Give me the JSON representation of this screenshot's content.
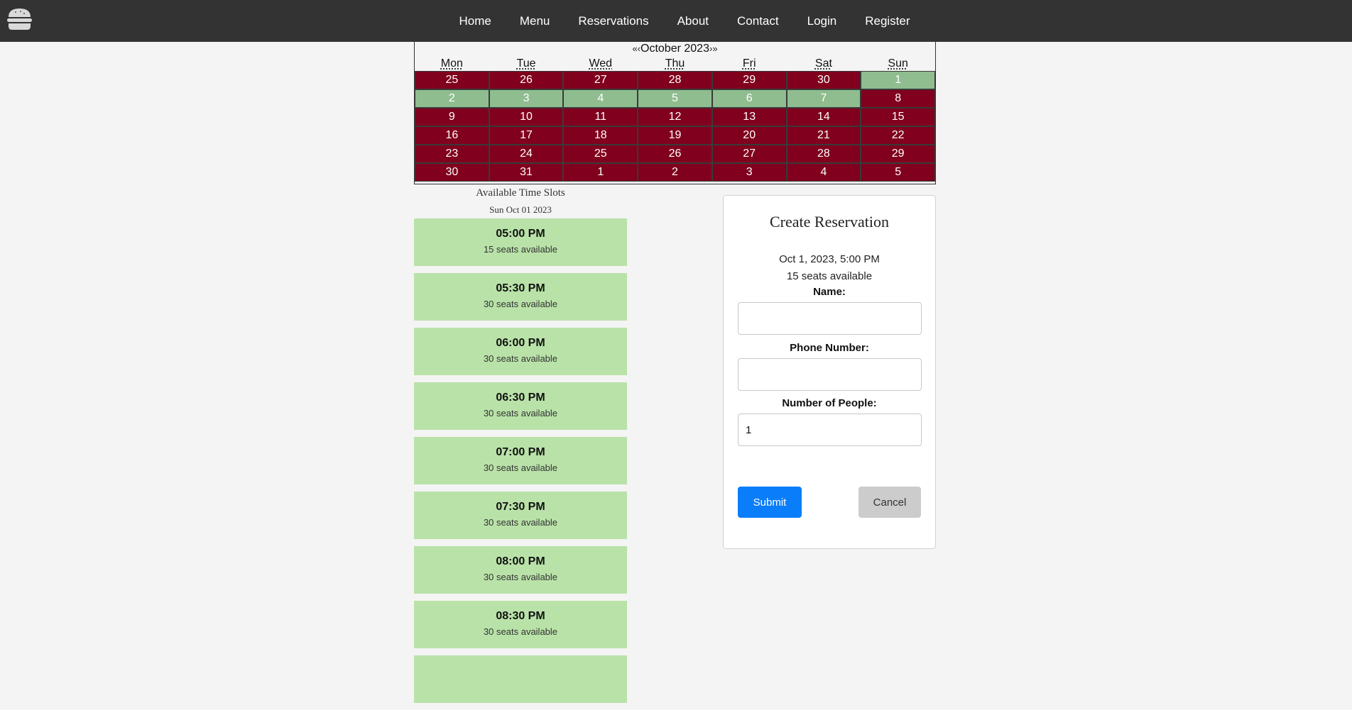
{
  "nav": {
    "logo_icon": "burger-icon",
    "links": [
      "Home",
      "Menu",
      "Reservations",
      "About",
      "Contact",
      "Login",
      "Register"
    ]
  },
  "calendar": {
    "prev_year": "«",
    "prev_month": "‹",
    "month_label": "October 2023",
    "next_month": "›",
    "next_year": "»",
    "weekdays": [
      "Mon",
      "Tue",
      "Wed",
      "Thu",
      "Fri",
      "Sat",
      "Sun"
    ],
    "days": [
      "25",
      "26",
      "27",
      "28",
      "29",
      "30",
      "1",
      "2",
      "3",
      "4",
      "5",
      "6",
      "7",
      "8",
      "9",
      "10",
      "11",
      "12",
      "13",
      "14",
      "15",
      "16",
      "17",
      "18",
      "19",
      "20",
      "21",
      "22",
      "23",
      "24",
      "25",
      "26",
      "27",
      "28",
      "29",
      "30",
      "31",
      "1",
      "2",
      "3",
      "4",
      "5"
    ],
    "available_indices": [
      6,
      7,
      8,
      9,
      10,
      11,
      12
    ],
    "colors": {
      "unavailable": "#80001d",
      "available": "#8fbd8f"
    }
  },
  "slots": {
    "title": "Available Time Slots",
    "date": "Sun Oct 01 2023",
    "items": [
      {
        "time": "05:00 PM",
        "seats": "15 seats available"
      },
      {
        "time": "05:30 PM",
        "seats": "30 seats available"
      },
      {
        "time": "06:00 PM",
        "seats": "30 seats available"
      },
      {
        "time": "06:30 PM",
        "seats": "30 seats available"
      },
      {
        "time": "07:00 PM",
        "seats": "30 seats available"
      },
      {
        "time": "07:30 PM",
        "seats": "30 seats available"
      },
      {
        "time": "08:00 PM",
        "seats": "30 seats available"
      },
      {
        "time": "08:30 PM",
        "seats": "30 seats available"
      },
      {
        "time": "",
        "seats": ""
      }
    ]
  },
  "form": {
    "title": "Create Reservation",
    "selected_datetime": "Oct 1, 2023, 5:00 PM",
    "selected_seats": "15 seats available",
    "name_label": "Name:",
    "name_value": "",
    "phone_label": "Phone Number:",
    "phone_value": "",
    "people_label": "Number of People:",
    "people_value": "1",
    "submit_label": "Submit",
    "cancel_label": "Cancel"
  }
}
